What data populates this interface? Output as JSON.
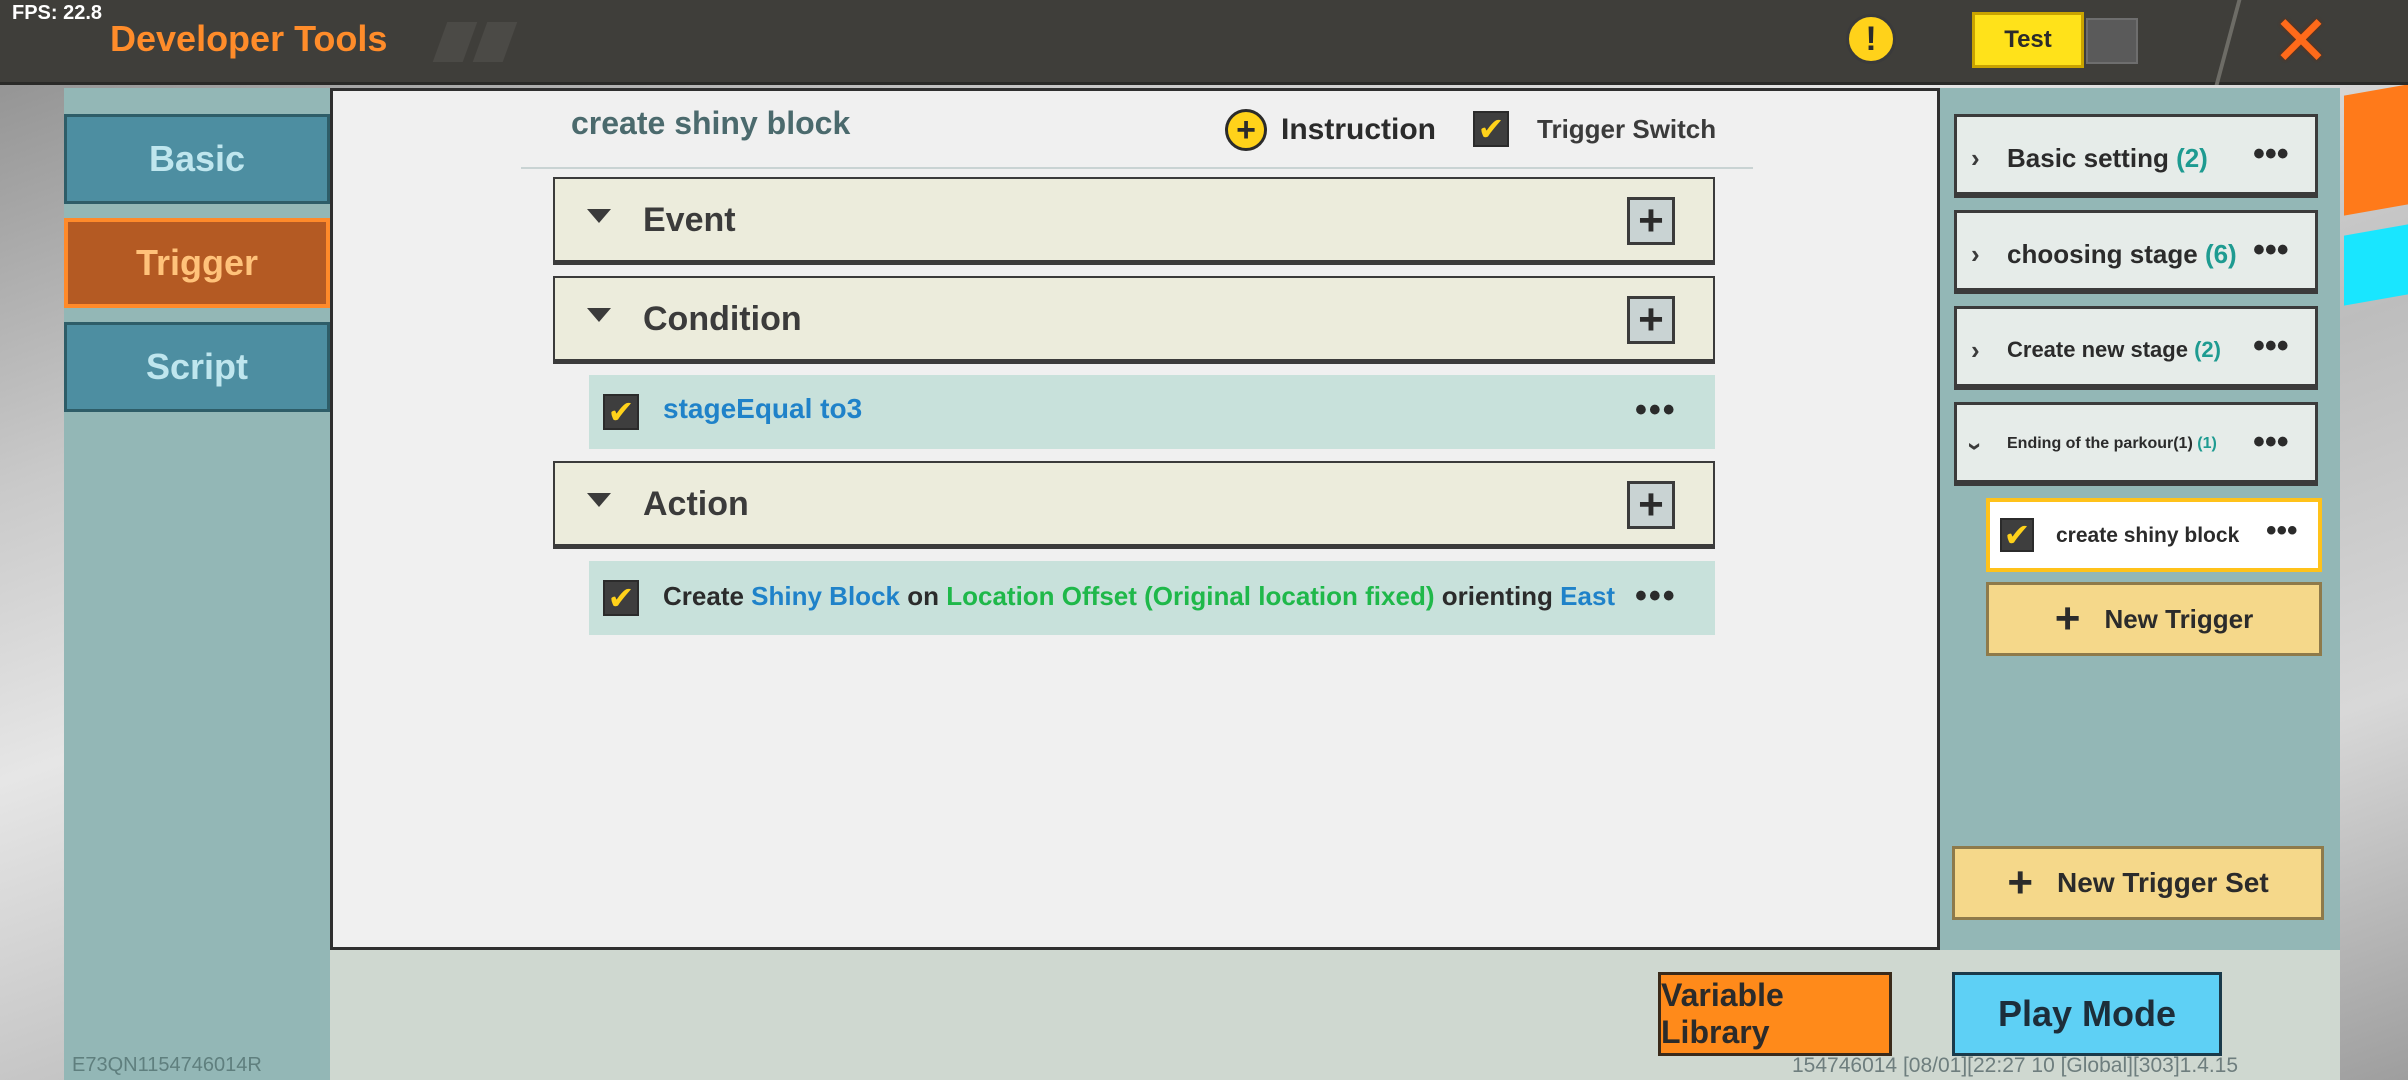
{
  "fps": "FPS: 22.8",
  "app_title": "Developer Tools",
  "test_label": "Test",
  "sidebar": {
    "tabs": [
      {
        "label": "Basic"
      },
      {
        "label": "Trigger"
      },
      {
        "label": "Script"
      }
    ]
  },
  "main": {
    "trigger_name": "create shiny block",
    "instruction_label": "Instruction",
    "trigger_switch_label": "Trigger Switch",
    "sections": {
      "event": "Event",
      "condition": "Condition",
      "action": "Action"
    },
    "condition_item": "stageEqual to3",
    "action_item": {
      "w1": "Create",
      "w2": "Shiny Block",
      "w3": "on",
      "w4": "Location Offset (Original location fixed)",
      "w5": "orienting",
      "w6": "East"
    }
  },
  "trigger_sets": [
    {
      "name": "Basic setting",
      "count": "(2)"
    },
    {
      "name": "choosing stage",
      "count": "(6)"
    },
    {
      "name": "Create new stage",
      "count": "(2)"
    },
    {
      "name": "Ending of the parkour(1)",
      "count": "(1)"
    }
  ],
  "child_trigger": "create shiny block",
  "new_trigger_label": "New Trigger",
  "new_trigger_set_label": "New Trigger Set",
  "variable_library_label": "Variable Library",
  "play_mode_label": "Play Mode",
  "device_id": "E73QN1154746014R",
  "build_info": "154746014   [08/01][22:27 10  [Global][303]1.4.15",
  "colors": {
    "accent_orange": "#ff8c2a",
    "sidebar_teal": "#93b7b6",
    "checkbox_yellow": "#ffd21a",
    "param_blue": "#1f82c9",
    "param_green": "#1fb84a",
    "count_teal": "#1e9b91"
  },
  "icons": {
    "warning": "warning-icon",
    "close": "close-icon",
    "add": "plus-icon",
    "more": "more-dots-icon",
    "expand": "chevron-right-icon",
    "collapse": "chevron-down-icon"
  }
}
